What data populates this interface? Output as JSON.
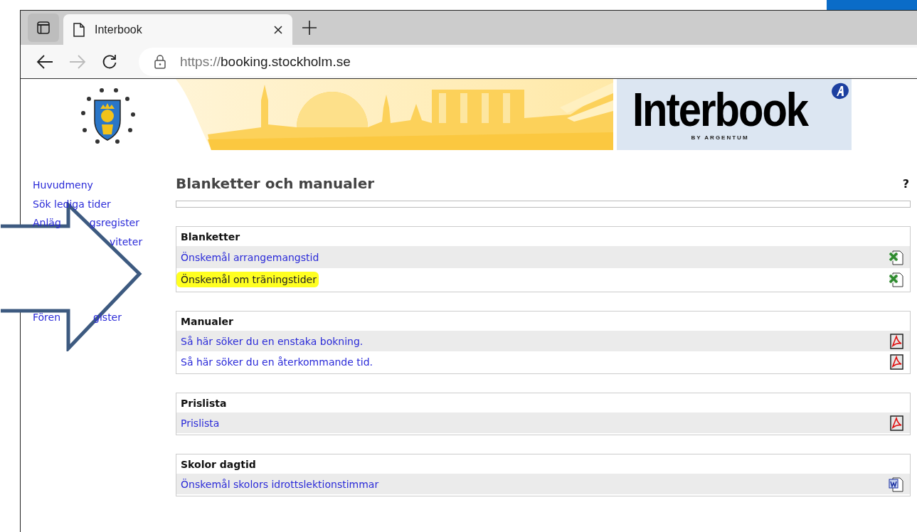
{
  "browser": {
    "tab_title": "Interbook",
    "url_scheme": "https://",
    "url_host": "booking.stockholm.se"
  },
  "header": {
    "logo_text": "Interbook",
    "logo_sub": "BY ARGENTUM"
  },
  "sidebar": {
    "lines": [
      {
        "fragments": [
          "Huvudmeny"
        ]
      },
      {
        "fragments": [
          "Sök lediga tider"
        ]
      },
      {
        "fragments": [
          "Anläg",
          "gsregister"
        ]
      },
      {
        "fragments": [
          "viteter"
        ]
      },
      {
        "fragments": [
          "Fören",
          "gister"
        ]
      }
    ]
  },
  "page": {
    "title": "Blanketter och manualer",
    "help": "?"
  },
  "sections": [
    {
      "title": "Blanketter",
      "items": [
        {
          "label": "Önskemål arrangemangstid",
          "kind": "excel",
          "highlighted": false
        },
        {
          "label": "Önskemål om träningstider",
          "kind": "excel",
          "highlighted": true
        }
      ]
    },
    {
      "title": "Manualer",
      "items": [
        {
          "label": "Så här söker du en enstaka bokning.",
          "kind": "pdf",
          "highlighted": false
        },
        {
          "label": "Så här söker du en återkommande tid.",
          "kind": "pdf",
          "highlighted": false
        }
      ]
    },
    {
      "title": "Prislista",
      "items": [
        {
          "label": "Prislista",
          "kind": "pdf",
          "highlighted": false
        }
      ]
    },
    {
      "title": "Skolor dagtid",
      "items": [
        {
          "label": "Önskemål skolors idrottslektionstimmar",
          "kind": "word",
          "highlighted": false
        }
      ]
    }
  ]
}
